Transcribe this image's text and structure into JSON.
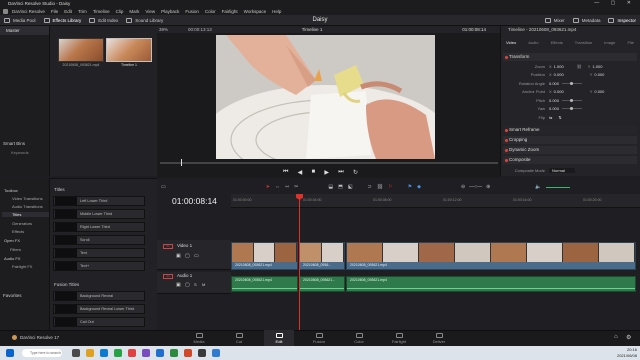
{
  "window": {
    "title": "DaVinci Resolve Studio - Daisy",
    "controls": "— ▢ ✕"
  },
  "menu": [
    "DaVinci Resolve",
    "File",
    "Edit",
    "Trim",
    "Timeline",
    "Clip",
    "Mark",
    "View",
    "Playback",
    "Fusion",
    "Color",
    "Fairlight",
    "Workspace",
    "Help"
  ],
  "toolbar": {
    "left": [
      "Media Pool",
      "Effects Library",
      "Edit Index",
      "Sound Library"
    ],
    "project": "Daisy",
    "right": [
      "Mixer",
      "Metadata",
      "Inspector"
    ]
  },
  "mediapool": {
    "bin": "Master",
    "smart_bins": "Smart Bins",
    "keywords": "Keywords",
    "clips": [
      {
        "label": "20210608_093621.mp4"
      },
      {
        "label": "Timeline 1"
      }
    ]
  },
  "viewer": {
    "zoom": "39%",
    "timecode": "00:00:13:13",
    "timeline_name": "Timeline 1",
    "current_tc": "01:00:08:14"
  },
  "inspector": {
    "clip": "Timeline - 20210608_093621.mp4",
    "tabs": [
      "Video",
      "Audio",
      "Effects",
      "Transition",
      "Image",
      "File"
    ],
    "sections": [
      "Transform",
      "Smart Reframe",
      "Cropping",
      "Dynamic Zoom",
      "Composite"
    ],
    "rows": [
      {
        "label": "Zoom",
        "x_label": "X",
        "x": "1.000",
        "y_label": "Y",
        "y": "1.000"
      },
      {
        "label": "Position",
        "x_label": "X",
        "x": "0.000",
        "y_label": "Y",
        "y": "0.000"
      },
      {
        "label": "Rotation Angle",
        "x": "0.000"
      },
      {
        "label": "Anchor Point",
        "x_label": "X",
        "x": "0.000",
        "y_label": "Y",
        "y": "0.000"
      },
      {
        "label": "Pitch",
        "x": "0.000"
      },
      {
        "label": "Yaw",
        "x": "0.000"
      },
      {
        "label": "Flip"
      }
    ],
    "composite_mode_label": "Composite Mode",
    "composite_mode": "Normal"
  },
  "fx": {
    "tree": [
      "Toolbox",
      "Video Transitions",
      "Audio Transitions",
      "Titles",
      "Generators",
      "Effects",
      "Open FX",
      "Filters",
      "Audio FX",
      "Fairlight FX"
    ],
    "favorites": "Favorites",
    "titles_header": "Titles",
    "titles": [
      "Left Lower Third",
      "Middle Lower Third",
      "Right Lower Third",
      "Scroll",
      "Text",
      "Text+"
    ],
    "fusion_header": "Fusion Titles",
    "fusion": [
      "Background Reveal",
      "Background Reveal Lower Third",
      "Call Out"
    ]
  },
  "timeline": {
    "timecode": "01:00:08:14",
    "ruler": [
      "01:00:00:00",
      "01:00:04:00",
      "01:00:08:00",
      "01:00:12:00",
      "01:00:16:00",
      "01:00:20:00"
    ],
    "video_track": {
      "badge": "V1",
      "name": "Video 1"
    },
    "audio_track": {
      "badge": "A1",
      "name": "Audio 1"
    },
    "video_clips": [
      "20210608_093621.mp4",
      "20210608_0936...",
      "20210608_093621.mp4"
    ],
    "audio_clips": [
      "20210608_093621.mp4",
      "20210608_093621...",
      "20210608_093621.mp4"
    ]
  },
  "app_name": "DaVinci Resolve 17",
  "pages": [
    "Media",
    "Cut",
    "Edit",
    "Fusion",
    "Color",
    "Fairlight",
    "Deliver"
  ],
  "taskbar": {
    "search": "Type here to search",
    "time": "20:16",
    "date": "2021/06/08"
  },
  "colors": {
    "accent": "#e0302a",
    "video_clip": "#4a6c8a",
    "audio_clip": "#2f7a4b"
  }
}
